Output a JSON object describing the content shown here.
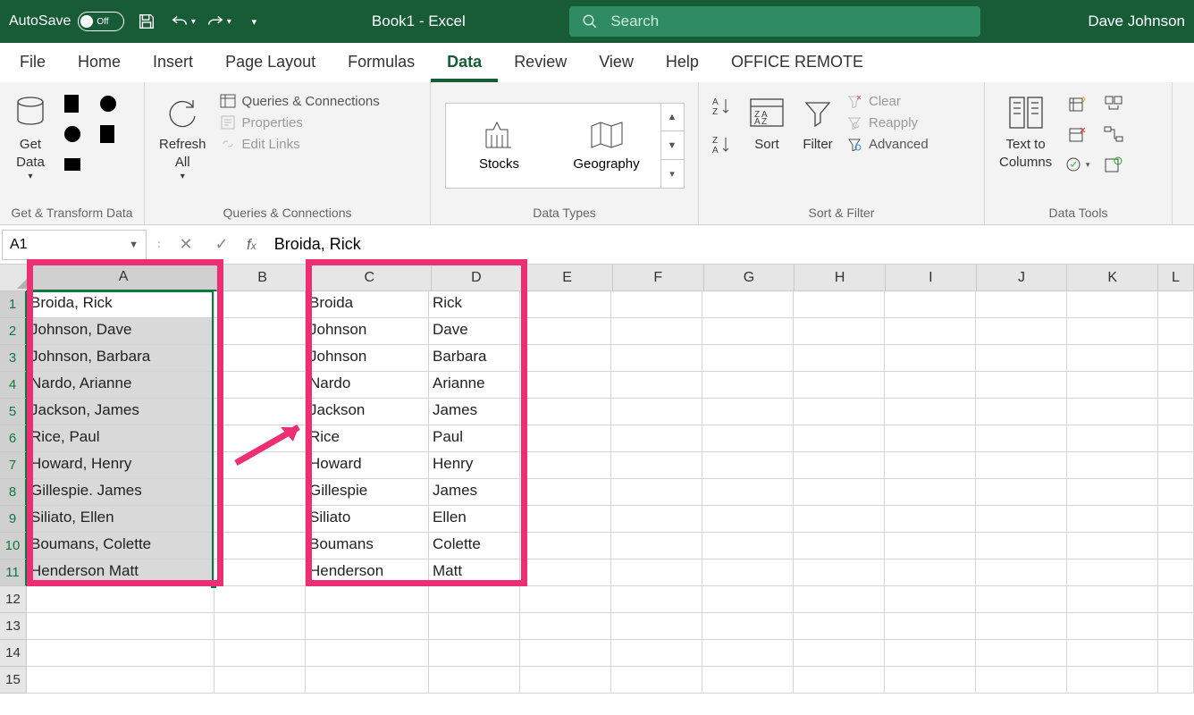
{
  "titlebar": {
    "autosave_label": "AutoSave",
    "autosave_state": "Off",
    "doc_title": "Book1  -  Excel",
    "search_placeholder": "Search",
    "user_name": "Dave Johnson"
  },
  "tabs": [
    "File",
    "Home",
    "Insert",
    "Page Layout",
    "Formulas",
    "Data",
    "Review",
    "View",
    "Help",
    "OFFICE REMOTE"
  ],
  "active_tab": "Data",
  "ribbon": {
    "groups": {
      "get_transform": {
        "label": "Get & Transform Data",
        "get_data": "Get\nData"
      },
      "queries": {
        "label": "Queries & Connections",
        "refresh_all": "Refresh\nAll",
        "items": [
          "Queries & Connections",
          "Properties",
          "Edit Links"
        ]
      },
      "data_types": {
        "label": "Data Types",
        "stocks": "Stocks",
        "geography": "Geography"
      },
      "sort_filter": {
        "label": "Sort & Filter",
        "sort": "Sort",
        "filter": "Filter",
        "clear": "Clear",
        "reapply": "Reapply",
        "advanced": "Advanced"
      },
      "data_tools": {
        "label": "Data Tools",
        "text_to_columns": "Text to\nColumns"
      }
    }
  },
  "formula_bar": {
    "name_box": "A1",
    "formula": "Broida, Rick"
  },
  "columns": {
    "A": 210,
    "B": 102,
    "C": 138,
    "D": 102,
    "E": 102,
    "F": 102,
    "G": 102,
    "H": 102,
    "I": 102,
    "J": 102,
    "K": 102,
    "L": 40
  },
  "rows": [
    {
      "n": 1,
      "A": "Broida, Rick",
      "C": "Broida",
      "D": "Rick"
    },
    {
      "n": 2,
      "A": "Johnson, Dave",
      "C": "Johnson",
      "D": "Dave"
    },
    {
      "n": 3,
      "A": "Johnson, Barbara",
      "C": "Johnson",
      "D": "Barbara"
    },
    {
      "n": 4,
      "A": "Nardo, Arianne",
      "C": "Nardo",
      "D": "Arianne"
    },
    {
      "n": 5,
      "A": "Jackson, James",
      "C": "Jackson",
      "D": "James"
    },
    {
      "n": 6,
      "A": "Rice, Paul",
      "C": "Rice",
      "D": "Paul"
    },
    {
      "n": 7,
      "A": "Howard, Henry",
      "C": "Howard",
      "D": "Henry"
    },
    {
      "n": 8,
      "A": "Gillespie. James",
      "C": "Gillespie",
      "D": "James"
    },
    {
      "n": 9,
      "A": "Siliato, Ellen",
      "C": "Siliato",
      "D": "Ellen"
    },
    {
      "n": 10,
      "A": "Boumans, Colette",
      "C": "Boumans",
      "D": "Colette"
    },
    {
      "n": 11,
      "A": "Henderson Matt",
      "C": "Henderson",
      "D": "Matt"
    },
    {
      "n": 12
    },
    {
      "n": 13
    },
    {
      "n": 14
    },
    {
      "n": 15
    }
  ],
  "selection": {
    "range": "A1:A11",
    "active": "A1"
  }
}
